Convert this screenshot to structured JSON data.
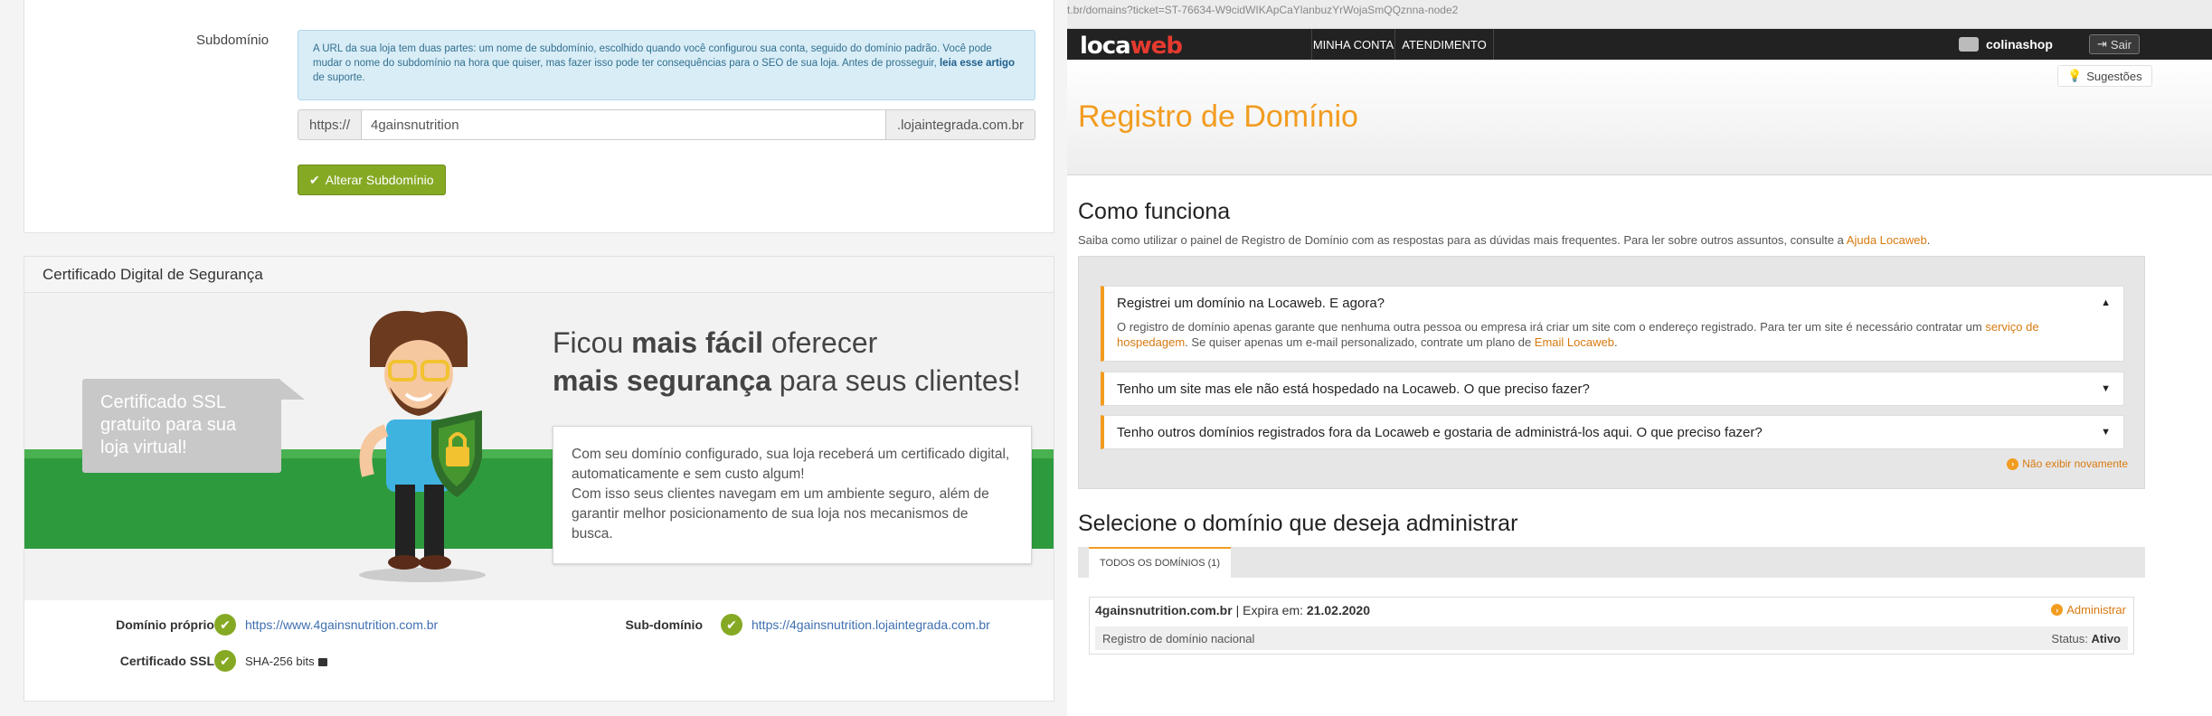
{
  "left": {
    "subdomain_label": "Subdomínio",
    "info_text": "A URL da sua loja tem duas partes: um nome de subdomínio, escolhido quando você configurou sua conta, seguido do domínio padrão. Você pode mudar o nome do subdomínio na hora que quiser, mas fazer isso pode ter consequências para o SEO de sua loja. Antes de prosseguir,",
    "info_link": "leia esse artigo",
    "info_tail": "de suporte.",
    "url_prefix": "https://",
    "subdomain_value": "4gainsnutrition",
    "url_suffix": ".lojaintegrada.com.br",
    "change_button": "Alterar Subdomínio",
    "cert_title": "Certificado Digital de Segurança",
    "bubble_text": "Certificado SSL gratuito para sua loja virtual!",
    "headline_1a": "Ficou ",
    "headline_1b": "mais fácil",
    "headline_1c": " oferecer",
    "headline_2a": "mais segurança",
    "headline_2b": " para seus clientes!",
    "card_p1": "Com seu domínio configurado, sua loja receberá um certificado digital, automaticamente e sem custo algum!",
    "card_p2": "Com isso seus clientes navegam em um ambiente seguro, além de garantir melhor posicionamento de sua loja nos mecanismos de busca.",
    "own_domain_label": "Domínio próprio",
    "own_domain_link": "https://www.4gainsnutrition.com.br",
    "subdomain_key": "Sub-domínio",
    "subdomain_link": "https://4gainsnutrition.lojaintegrada.com.br",
    "ssl_label": "Certificado SSL",
    "ssl_value": "SHA-256 bits"
  },
  "right": {
    "url_fragment": "t.br/domains?ticket=ST-76634-W9cidWIKApCaYlanbuzYrWojaSmQQznna-node2",
    "logo_a": "loca",
    "logo_b": "web",
    "nav": [
      "MINHA CONTA",
      "ATENDIMENTO"
    ],
    "user": "colinashop",
    "sair": "Sair",
    "suggestions": "Sugestões",
    "page_title": "Registro de Domínio",
    "how_title": "Como funciona",
    "how_sub": "Saiba como utilizar o painel de Registro de Domínio com as respostas para as dúvidas mais frequentes. Para ler sobre outros assuntos, consulte a",
    "how_link": "Ajuda Locaweb",
    "faq": [
      {
        "q": "Registrei um domínio na Locaweb. E agora?",
        "a1": "O registro de domínio apenas garante que nenhuma outra pessoa ou empresa irá criar um site com o endereço registrado. Para ter um site é necessário contratar um",
        "a_link1": "serviço de hospedagem",
        "a2": ". Se quiser apenas um e-mail personalizado, contrate um plano de",
        "a_link2": "Email Locaweb",
        "a3": "."
      },
      {
        "q": "Tenho um site mas ele não está hospedado na Locaweb. O que preciso fazer?"
      },
      {
        "q": "Tenho outros domínios registrados fora da Locaweb e gostaria de administrá-los aqui. O que preciso fazer?"
      }
    ],
    "no_show": "Não exibir novamente",
    "select_title": "Selecione o domínio que deseja administrar",
    "tab_all": "TODOS OS DOMÍNIOS (1)",
    "domain": "4gainsnutrition.com.br",
    "expires_label": "| Expira em:",
    "expires": "21.02.2020",
    "admin": "Administrar",
    "reg_type": "Registro de domínio nacional",
    "status_label": "Status:",
    "status": "Ativo"
  }
}
